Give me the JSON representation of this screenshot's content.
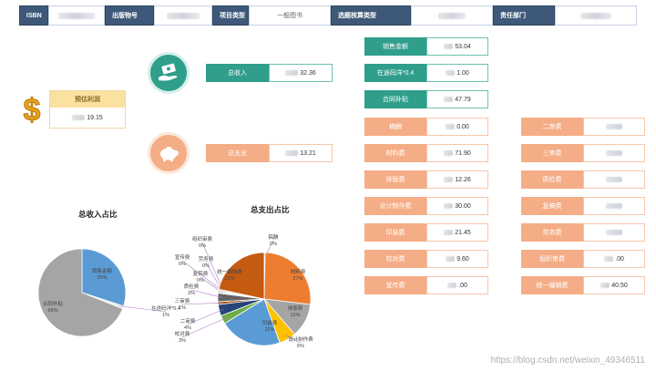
{
  "header": {
    "isbn_label": "ISBN",
    "publish_no_label": "出版物号",
    "project_type_label": "项目类型",
    "project_type_value": "一般图书",
    "budget_type_label": "选题核算类型",
    "dept_label": "责任部门"
  },
  "profit": {
    "label": "预估利润",
    "value": "19.15"
  },
  "income": {
    "label": "总收入",
    "value": "32.36"
  },
  "expense": {
    "label": "总支出",
    "value": "13.21"
  },
  "revenue_items": [
    {
      "label": "销售金额",
      "value": "53.04"
    },
    {
      "label": "在途码洋*0.4",
      "value": "1.00"
    },
    {
      "label": "合同补贴",
      "value": "47.79"
    }
  ],
  "cost_items_left": [
    {
      "label": "稿酬",
      "value": "0.00"
    },
    {
      "label": "材料费",
      "value": "71.90"
    },
    {
      "label": "排版费",
      "value": "12.26"
    },
    {
      "label": "设计制作费",
      "value": "30.00"
    },
    {
      "label": "印装费",
      "value": "21.45"
    },
    {
      "label": "校对费",
      "value": "9.60"
    },
    {
      "label": "宣传费",
      "value": ".00"
    }
  ],
  "cost_items_right": [
    {
      "label": "二审费",
      "value": ""
    },
    {
      "label": "三审费",
      "value": ""
    },
    {
      "label": "质检费",
      "value": ""
    },
    {
      "label": "复稿费",
      "value": ""
    },
    {
      "label": "劳务费",
      "value": ""
    },
    {
      "label": "组织审费",
      "value": ".00"
    },
    {
      "label": "统一编辑费",
      "value": "40.50"
    }
  ],
  "chart_data": [
    {
      "type": "pie",
      "title": "总收入占比",
      "slices": [
        {
          "name": "销售金额",
          "percent": "30%",
          "value": 30,
          "color": "#5b9bd5"
        },
        {
          "name": "在途码洋*0.4",
          "percent": "1%",
          "value": 1,
          "color": "#e8e8e8"
        },
        {
          "name": "合同补贴",
          "percent": "69%",
          "value": 69,
          "color": "#a5a5a5"
        }
      ]
    },
    {
      "type": "pie",
      "title": "总支出占比",
      "slices": [
        {
          "name": "稿酬",
          "percent": "0%",
          "value": 0,
          "color": "#4472c4"
        },
        {
          "name": "材料费",
          "percent": "27%",
          "value": 27,
          "color": "#ed7d31"
        },
        {
          "name": "排版费",
          "percent": "12%",
          "value": 12,
          "color": "#a5a5a5"
        },
        {
          "name": "设计制作费",
          "percent": "6%",
          "value": 6,
          "color": "#ffc000"
        },
        {
          "name": "印装费",
          "percent": "22%",
          "value": 22,
          "color": "#5b9bd5"
        },
        {
          "name": "校对费",
          "percent": "3%",
          "value": 3,
          "color": "#70ad47"
        },
        {
          "name": "二审费",
          "percent": "4%",
          "value": 4,
          "color": "#264478"
        },
        {
          "name": "三审费",
          "percent": "1%",
          "value": 1,
          "color": "#9e480e"
        },
        {
          "name": "质检费",
          "percent": "3%",
          "value": 3,
          "color": "#636363"
        },
        {
          "name": "复稿费",
          "percent": "0%",
          "value": 0,
          "color": "#997300"
        },
        {
          "name": "劳务费",
          "percent": "0%",
          "value": 0,
          "color": "#255e91"
        },
        {
          "name": "宣传费",
          "percent": "0%",
          "value": 0,
          "color": "#43682b"
        },
        {
          "name": "组织审费",
          "percent": "0%",
          "value": 0,
          "color": "#698ed0"
        },
        {
          "name": "统一编辑费",
          "percent": "22%",
          "value": 22,
          "color": "#c55a11"
        }
      ]
    }
  ],
  "watermark": "https://blog.csdn.net/weixin_49346511"
}
